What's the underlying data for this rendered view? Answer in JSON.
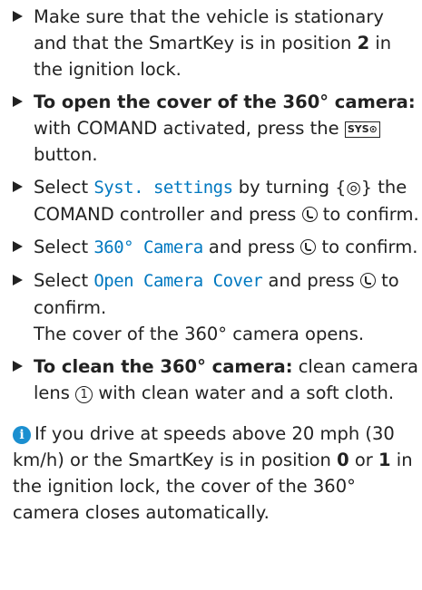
{
  "steps": [
    {
      "text": "Make sure that the vehicle is stationary and that the SmartKey is in position ",
      "bold": "2",
      "text_after": " in the ignition lock."
    },
    {
      "bold": "To open the cover of the 360° camera:",
      "text": " with COMAND activated, press the ",
      "button": "SYS⊙",
      "text_after": " button."
    },
    {
      "text": "Select ",
      "menu": "Syst. settings",
      "text_mid": " by turning ",
      "text_mid2": " the COMAND controller and press ",
      "text_after": " to confirm."
    },
    {
      "text": "Select ",
      "menu": "360° Camera",
      "text_mid": " and press ",
      "text_after": " to confirm."
    },
    {
      "text": "Select ",
      "menu": "Open Camera Cover",
      "text_mid": " and press ",
      "text_after": " to confirm.",
      "result": "The cover of the 360° camera opens."
    },
    {
      "bold": "To clean the 360° camera:",
      "text": " clean camera lens ",
      "num": "1",
      "text_after": " with clean water and a soft cloth."
    }
  ],
  "note": {
    "icon": "i",
    "text": "If you drive at speeds above 20 mph (30 km/h) or the SmartKey is in position ",
    "bold1": "0",
    "mid": " or ",
    "bold2": "1",
    "text_after": " in the ignition lock, the cover of the 360° camera closes automatically."
  },
  "symbols": {
    "controller_turn": "{◎}"
  },
  "colors": {
    "menu_text": "#0078c0",
    "info_icon": "#1b8fd0"
  }
}
